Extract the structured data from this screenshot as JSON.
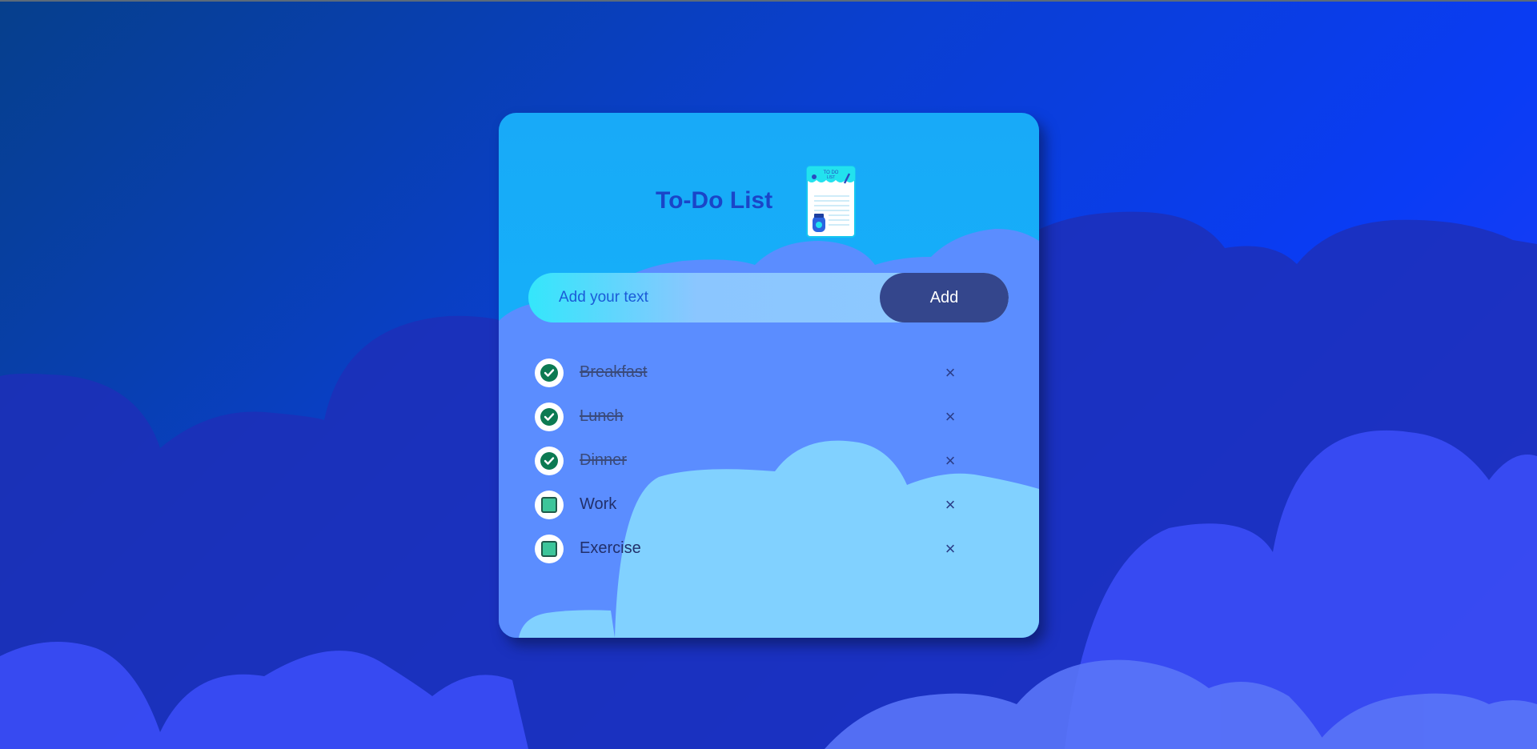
{
  "app": {
    "title": "To-Do List",
    "logo_icon": "todo-list-notepad-icon"
  },
  "input": {
    "placeholder": "Add your text",
    "value": "",
    "button_label": "Add"
  },
  "tasks": [
    {
      "label": "Breakfast",
      "done": true
    },
    {
      "label": "Lunch",
      "done": true
    },
    {
      "label": "Dinner",
      "done": true
    },
    {
      "label": "Work",
      "done": false
    },
    {
      "label": "Exercise",
      "done": false
    }
  ],
  "delete_symbol": "×",
  "colors": {
    "background_dark": "#063f8c",
    "background_bright": "#0a3cf5",
    "card": "#18aaf8",
    "title": "#1a45c8",
    "add_button": "#34468c",
    "check_done": "#0c7a52",
    "check_pending": "#3dc59a"
  }
}
